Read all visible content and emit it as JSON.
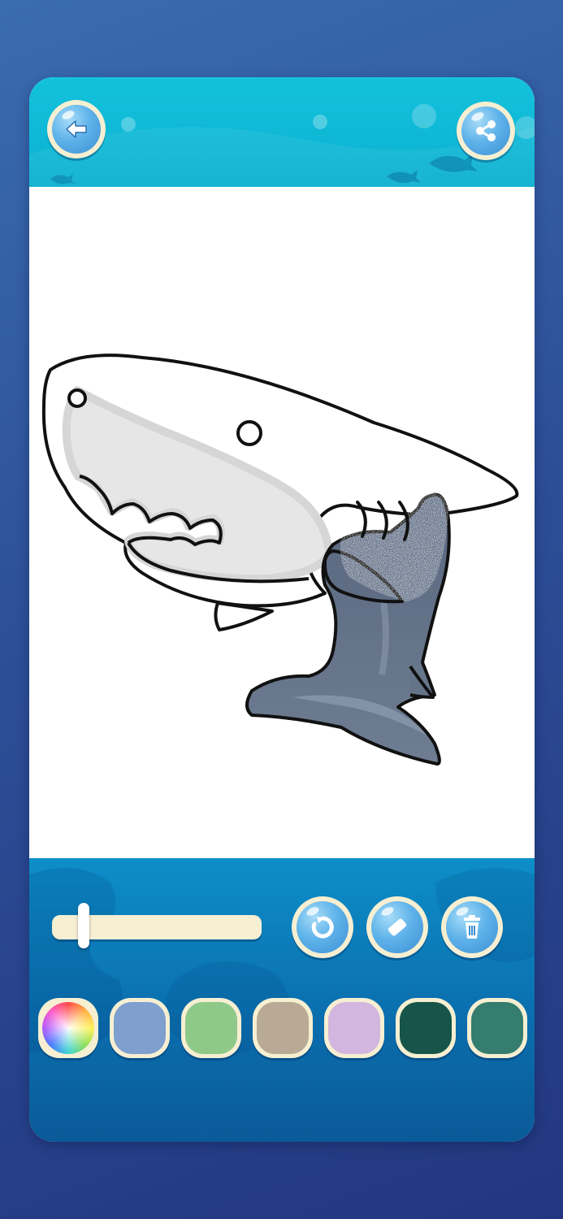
{
  "app": {
    "icons": {
      "back": "arrow-left-icon",
      "share": "share-icon",
      "undo": "undo-icon",
      "eraser": "eraser-icon",
      "trash": "trash-icon",
      "color_wheel": "color-wheel-icon"
    }
  },
  "brush_size": {
    "value": 0.15
  },
  "palette": {
    "swatches": [
      {
        "name": "color-wheel",
        "type": "wheel"
      },
      {
        "name": "periwinkle-blue",
        "color": "#7f9fcf"
      },
      {
        "name": "light-green",
        "color": "#8fc98a"
      },
      {
        "name": "taupe",
        "color": "#b8aa95"
      },
      {
        "name": "lilac",
        "color": "#d3b6df"
      },
      {
        "name": "dark-green",
        "color": "#17554a"
      },
      {
        "name": "teal-green",
        "color": "#347d6f"
      }
    ]
  },
  "colors": {
    "shark_gray": "#66748a",
    "shark_highlight": "#8a98ac",
    "outline": "#111111",
    "belly_shade": "#e6e6e6"
  }
}
